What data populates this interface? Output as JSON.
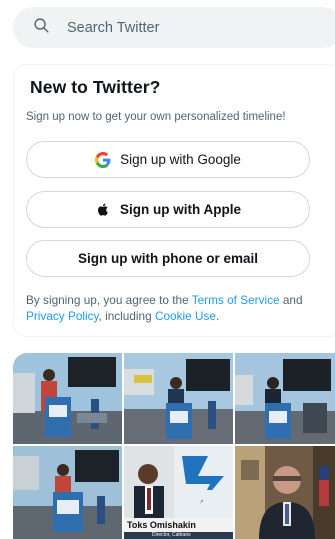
{
  "search": {
    "placeholder": "Search Twitter",
    "icon": "search-icon"
  },
  "signup_card": {
    "title": "New to Twitter?",
    "subtitle": "Sign up now to get your own personalized timeline!",
    "buttons": [
      {
        "label": "Sign up with Google",
        "icon": "google-logo-icon"
      },
      {
        "label": "Sign up with Apple",
        "icon": "apple-logo-icon"
      },
      {
        "label": "Sign up with phone or email"
      }
    ],
    "terms": {
      "prefix": "By signing up, you agree to the ",
      "terms_link": "Terms of Service",
      "and": " and",
      "privacy_link": "Privacy Policy",
      "middle": ", including ",
      "cookie_link": "Cookie Use",
      "suffix": "."
    }
  },
  "media": {
    "caption_name": "Toks Omishakin",
    "caption_title": "Director, Caltrans",
    "logo_text": "Caltrans"
  },
  "colors": {
    "accent": "#1d9bf0",
    "text_primary": "#0f1419",
    "text_secondary": "#536471",
    "search_bg": "#eff3f4",
    "border": "#cfd9de"
  }
}
